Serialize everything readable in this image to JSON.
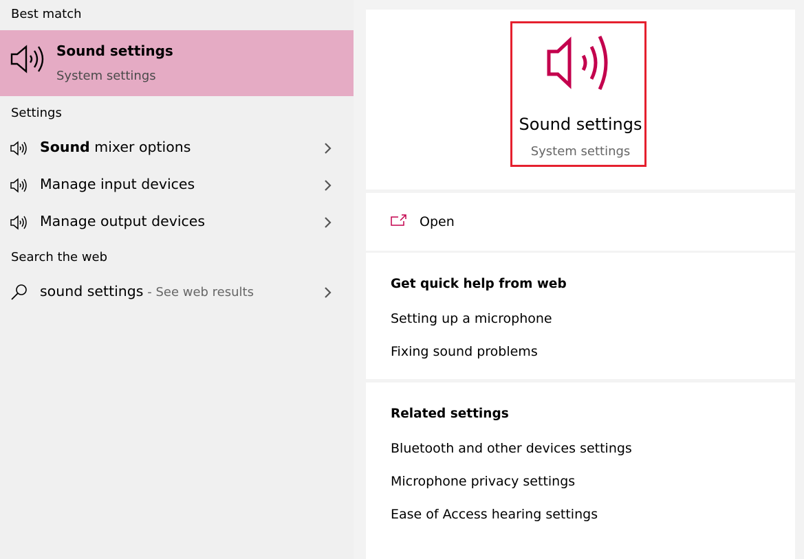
{
  "left": {
    "best_match_header": "Best match",
    "best_match": {
      "title": "Sound settings",
      "subtitle": "System settings",
      "icon": "speaker-icon"
    },
    "settings_header": "Settings",
    "settings_items": [
      {
        "bold": "Sound",
        "rest": " mixer options",
        "icon": "speaker-icon"
      },
      {
        "bold": "",
        "rest": "Manage input devices",
        "icon": "speaker-icon"
      },
      {
        "bold": "",
        "rest": "Manage output devices",
        "icon": "speaker-icon"
      }
    ],
    "web_header": "Search the web",
    "web_item": {
      "query": "sound settings",
      "suffix": " - See web results",
      "icon": "search-icon"
    }
  },
  "right": {
    "hero": {
      "title": "Sound settings",
      "subtitle": "System settings",
      "icon": "speaker-icon"
    },
    "open_label": "Open",
    "help_header": "Get quick help from web",
    "help_links": [
      "Setting up a microphone",
      "Fixing sound problems"
    ],
    "related_header": "Related settings",
    "related_links": [
      "Bluetooth and other devices settings",
      "Microphone privacy settings",
      "Ease of Access hearing settings"
    ]
  },
  "colors": {
    "highlight": "#e5abc4",
    "accent": "#c3004d",
    "selection_border": "#e5202e"
  }
}
